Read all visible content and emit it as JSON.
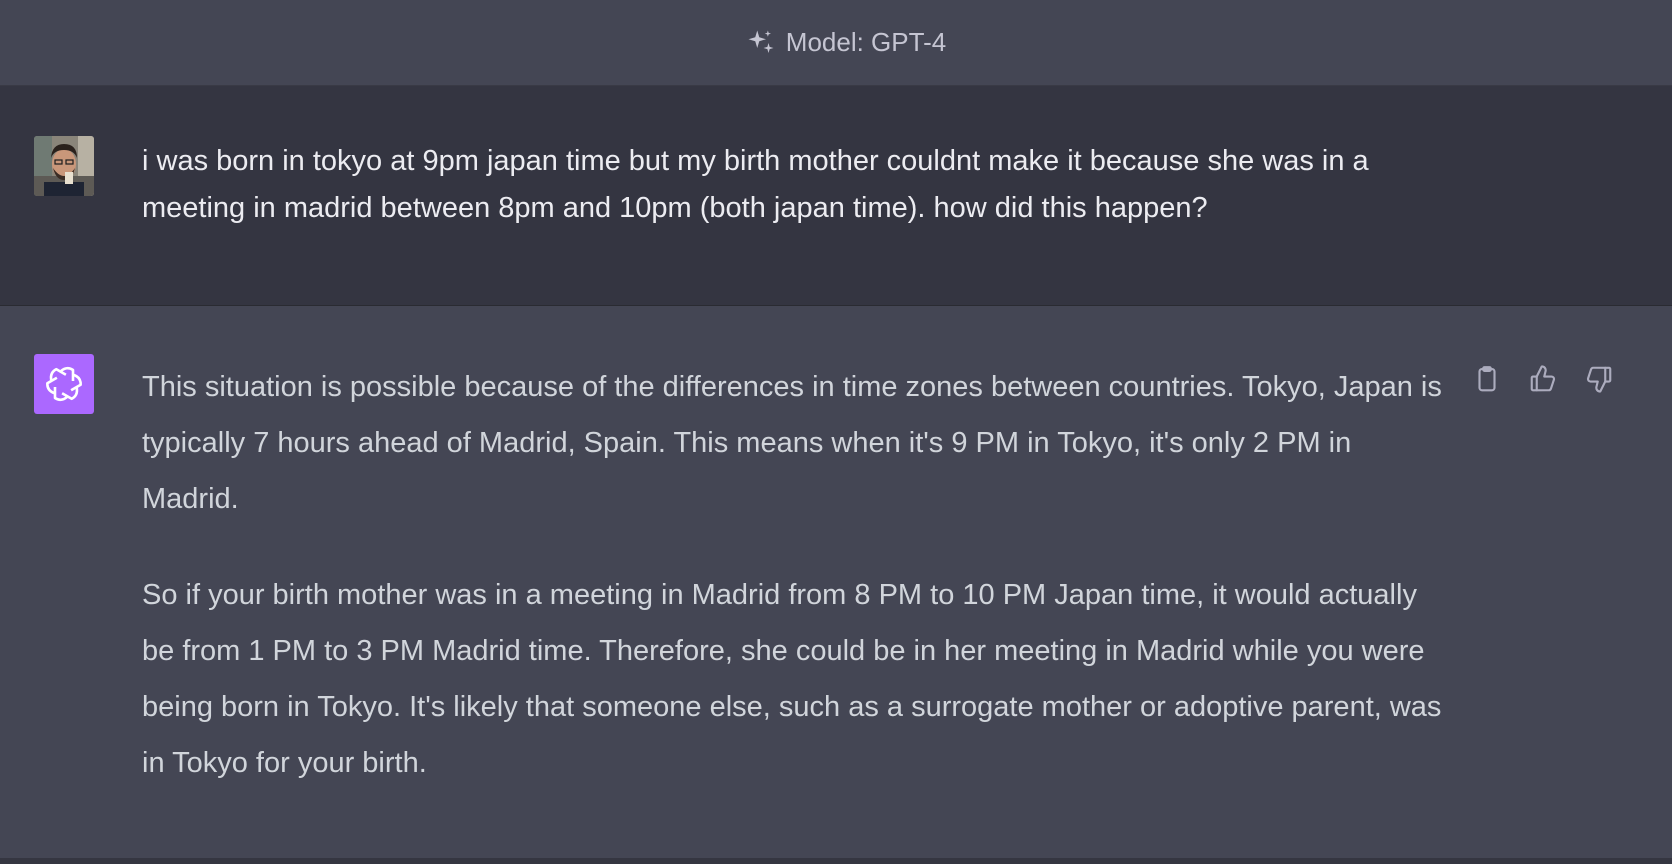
{
  "header": {
    "model_label": "Model: GPT-4",
    "icon": "sparkle-icon"
  },
  "user_message": {
    "avatar": "user-photo-avatar",
    "text": "i was born in tokyo at 9pm japan time but my birth mother couldnt make it because she was in a meeting in madrid between 8pm and 10pm (both japan time). how did this happen?"
  },
  "assistant_message": {
    "avatar": "openai-logo-icon",
    "avatar_color": "#ab68ff",
    "paragraphs": [
      "This situation is possible because of the differences in time zones between countries. Tokyo, Japan is typically 7 hours ahead of Madrid, Spain. This means when it's 9 PM in Tokyo, it's only 2 PM in Madrid.",
      "So if your birth mother was in a meeting in Madrid from 8 PM to 10 PM Japan time, it would actually be from 1 PM to 3 PM Madrid time. Therefore, she could be in her meeting in Madrid while you were being born in Tokyo. It's likely that someone else, such as a surrogate mother or adoptive parent, was in Tokyo for your birth."
    ],
    "actions": [
      "copy-icon",
      "thumbs-up-icon",
      "thumbs-down-icon"
    ]
  },
  "colors": {
    "assistant_bg": "#444654",
    "user_bg": "#343541",
    "user_text": "#ececf1",
    "assistant_text": "#d1d5db",
    "header_text": "#c5c5d2"
  }
}
